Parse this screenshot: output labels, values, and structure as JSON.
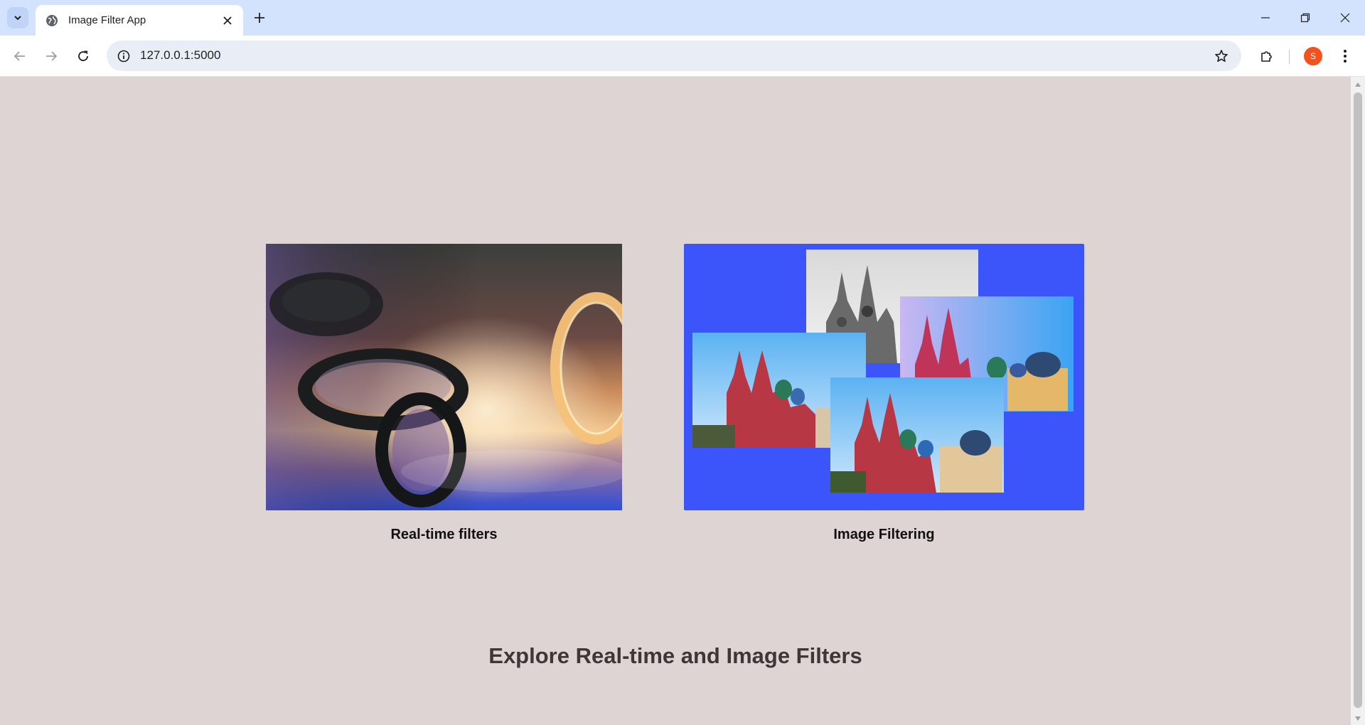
{
  "browser": {
    "tab_title": "Image Filter App",
    "url": "127.0.0.1:5000",
    "profile_initial": "S"
  },
  "page": {
    "cards": [
      {
        "caption": "Real-time filters",
        "image_description_icon": "lens-filters-photo"
      },
      {
        "caption": "Image Filtering",
        "image_description_icon": "filtered-cathedral-photos"
      }
    ],
    "headline": "Explore Real-time and Image Filters"
  },
  "colors": {
    "page_background": "#dfd4d4",
    "tabstrip": "#d3e3fd",
    "card2_background": "#3b55fb",
    "headline": "#3f3737",
    "avatar": "#f4511e"
  }
}
